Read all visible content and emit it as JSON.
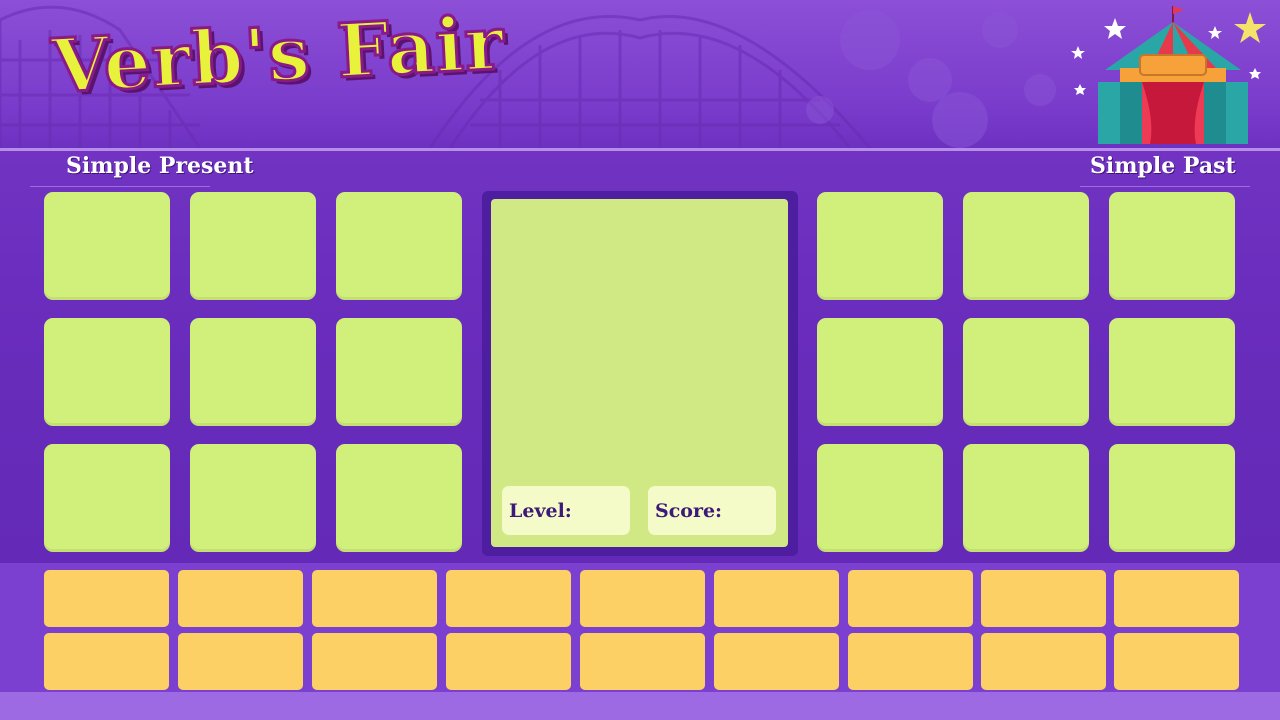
{
  "header": {
    "title": "Verb's Fair"
  },
  "labels": {
    "left_column": "Simple Present",
    "right_column": "Simple Past"
  },
  "center": {
    "level_label": "Level:",
    "score_label": "Score:"
  },
  "colors": {
    "background": "#6a2dbd",
    "card": "#d1ef7b",
    "center_panel": "#d1e985",
    "stat_box": "#f4fac8",
    "answer_slot": "#fdd066",
    "title": "#e9f23a"
  },
  "icons": [
    "circus-tent-icon",
    "star-icon",
    "roller-coaster-decoration"
  ]
}
